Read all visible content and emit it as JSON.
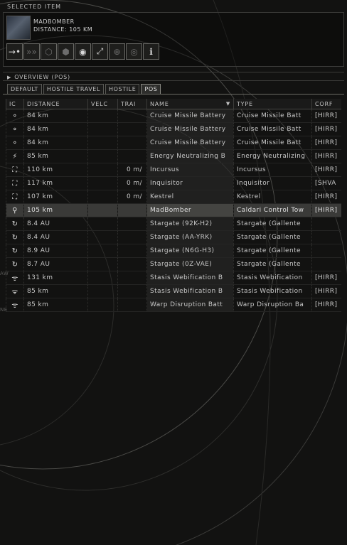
{
  "selected_item": {
    "panel_title": "SELECTED ITEM",
    "name": "MADBOMBER",
    "distance": "DISTANCE: 105 KM",
    "actions": [
      {
        "icon": "approach-icon"
      },
      {
        "icon": "warp-to-icon"
      },
      {
        "icon": "lock-target-icon"
      },
      {
        "icon": "unlock-icon"
      },
      {
        "icon": "orbit-icon"
      },
      {
        "icon": "keep-at-range-icon"
      },
      {
        "icon": "target-icon"
      },
      {
        "icon": "look-at-icon"
      },
      {
        "icon": "show-info-icon"
      }
    ]
  },
  "overview": {
    "header": "OVERVIEW (POS)",
    "tabs": [
      "DEFAULT",
      "HOSTILE TRAVEL",
      "HOSTILE",
      "POS"
    ],
    "active_tab": "POS",
    "columns": [
      "IC",
      "DISTANCE",
      "VELC",
      "TRAI",
      "NAME",
      "TYPE",
      "CORF"
    ],
    "rows": [
      {
        "icon": "battery-icon",
        "distance": "84 km",
        "velocity": "",
        "transversal": "",
        "name": "Cruise Missile Battery",
        "type": "Cruise Missile Batt",
        "corp": "[HIRR]"
      },
      {
        "icon": "battery-icon",
        "distance": "84 km",
        "velocity": "",
        "transversal": "",
        "name": "Cruise Missile Battery",
        "type": "Cruise Missile Batt",
        "corp": "[HIRR]"
      },
      {
        "icon": "battery-icon",
        "distance": "84 km",
        "velocity": "",
        "transversal": "",
        "name": "Cruise Missile Battery",
        "type": "Cruise Missile Batt",
        "corp": "[HIRR]"
      },
      {
        "icon": "lightning-icon",
        "distance": "85 km",
        "velocity": "",
        "transversal": "",
        "name": "Energy Neutralizing B",
        "type": "Energy Neutralizing",
        "corp": "[HIRR]"
      },
      {
        "icon": "ship-bracket-icon",
        "distance": "110 km",
        "velocity": "",
        "transversal": "0 m/",
        "name": "Incursus",
        "type": "Incursus",
        "corp": "[HIRR]"
      },
      {
        "icon": "ship-bracket-icon",
        "distance": "117 km",
        "velocity": "",
        "transversal": "0 m/",
        "name": "Inquisitor",
        "type": "Inquisitor",
        "corp": "[SHVA"
      },
      {
        "icon": "ship-bracket-icon",
        "distance": "107 km",
        "velocity": "",
        "transversal": "0 m/",
        "name": "Kestrel",
        "type": "Kestrel",
        "corp": "[HIRR]"
      },
      {
        "icon": "control-tower-icon",
        "distance": "105 km",
        "velocity": "",
        "transversal": "",
        "name": "MadBomber",
        "type": "Caldari Control Tow",
        "corp": "[HIRR]",
        "selected": true
      },
      {
        "icon": "stargate-icon",
        "distance": "8.4 AU",
        "velocity": "",
        "transversal": "",
        "name": "Stargate (92K-H2)",
        "type": "Stargate (Gallente",
        "corp": ""
      },
      {
        "icon": "stargate-icon",
        "distance": "8.4 AU",
        "velocity": "",
        "transversal": "",
        "name": "Stargate (AA-YRK)",
        "type": "Stargate (Gallente",
        "corp": ""
      },
      {
        "icon": "stargate-icon",
        "distance": "8.9 AU",
        "velocity": "",
        "transversal": "",
        "name": "Stargate (N6G-H3)",
        "type": "Stargate (Gallente",
        "corp": ""
      },
      {
        "icon": "stargate-icon",
        "distance": "8.7 AU",
        "velocity": "",
        "transversal": "",
        "name": "Stargate (0Z-VAE)",
        "type": "Stargate (Gallente",
        "corp": ""
      },
      {
        "icon": "stasis-icon",
        "distance": "131 km",
        "velocity": "",
        "transversal": "",
        "name": "Stasis Webification B",
        "type": "Stasis Webification",
        "corp": "[HIRR]"
      },
      {
        "icon": "stasis-icon",
        "distance": "85 km",
        "velocity": "",
        "transversal": "",
        "name": "Stasis Webification B",
        "type": "Stasis Webification",
        "corp": "[HIRR]"
      },
      {
        "icon": "stasis-icon",
        "distance": "85 km",
        "velocity": "",
        "transversal": "",
        "name": "Warp Disruption Batt",
        "type": "Warp Disruption Ba",
        "corp": "[HIRR]"
      }
    ]
  }
}
